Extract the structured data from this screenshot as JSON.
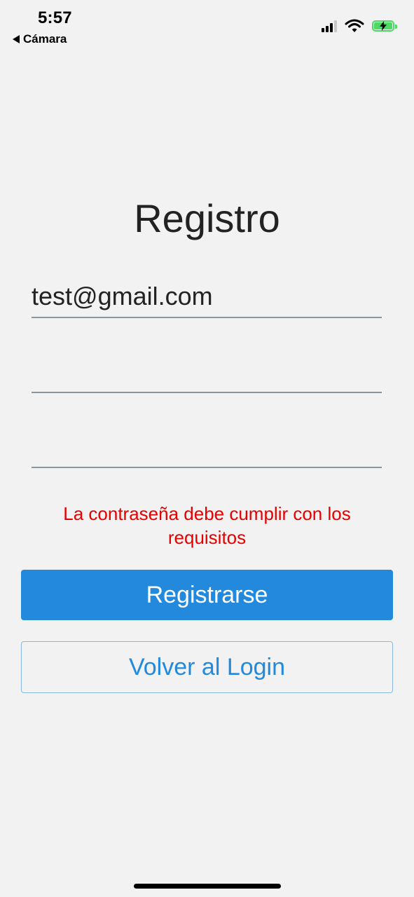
{
  "status_bar": {
    "time": "5:57",
    "back_app": "Cámara",
    "icons": [
      "cellular-signal-icon",
      "wifi-icon",
      "battery-charging-icon"
    ],
    "battery_color": "#4dd964"
  },
  "screen": {
    "title": "Registro",
    "email_value": "test@gmail.com",
    "password_value": "",
    "confirm_password_value": "",
    "error_message": "La contraseña debe cumplir con los requisitos",
    "register_button": "Registrarse",
    "back_login_button": "Volver al Login"
  },
  "colors": {
    "background": "#f2f2f2",
    "primary": "#2289dd",
    "error": "#e60000",
    "field_underline": "#8a95a0"
  }
}
